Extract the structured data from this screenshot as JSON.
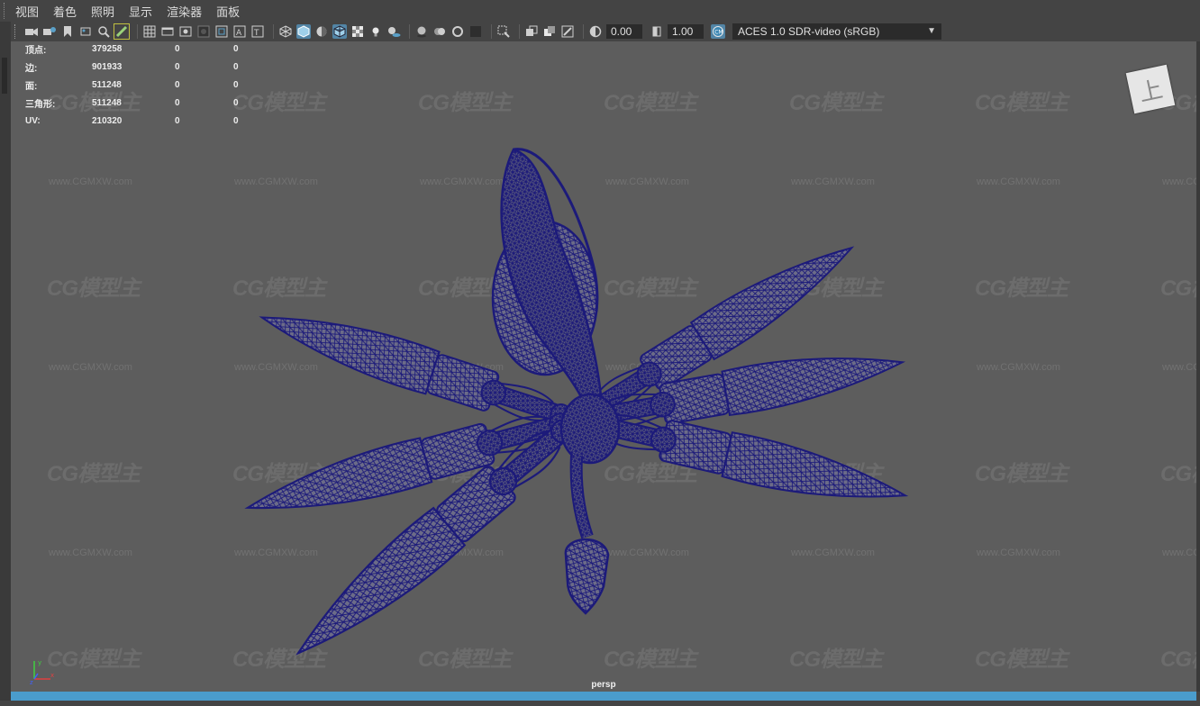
{
  "menu": {
    "items": [
      "视图",
      "着色",
      "照明",
      "显示",
      "渲染器",
      "面板"
    ]
  },
  "toolbar": {
    "tools": [
      {
        "icon": "camera-icon"
      },
      {
        "icon": "camera-attr-icon"
      },
      {
        "icon": "bookmark-icon"
      },
      {
        "icon": "image-plane-icon"
      },
      {
        "icon": "2d-pan-zoom-icon"
      },
      {
        "icon": "grease-pencil-icon"
      },
      {
        "icon": "grid-icon"
      },
      {
        "icon": "film-gate-icon"
      },
      {
        "icon": "resolution-gate-icon"
      },
      {
        "icon": "gate-mask-icon"
      },
      {
        "icon": "field-chart-icon"
      },
      {
        "icon": "safe-action-icon"
      },
      {
        "icon": "safe-title-icon"
      },
      {
        "icon": "wireframe-icon"
      },
      {
        "icon": "smooth-shade-icon"
      },
      {
        "icon": "default-material-icon"
      },
      {
        "icon": "wireframe-on-shaded-icon"
      },
      {
        "icon": "textured-icon"
      },
      {
        "icon": "use-all-lights-icon"
      },
      {
        "icon": "shadows-icon"
      },
      {
        "icon": "screen-space-ao-icon"
      },
      {
        "icon": "motion-blur-icon"
      },
      {
        "icon": "anti-aliasing-icon"
      },
      {
        "icon": "depth-of-field-icon"
      },
      {
        "icon": "isolate-select-icon"
      },
      {
        "icon": "xray-icon"
      },
      {
        "icon": "xray-active-icon"
      },
      {
        "icon": "xray-joints-icon"
      },
      {
        "icon": "backface-culling-icon"
      },
      {
        "icon": "exposure-icon"
      },
      {
        "icon": "gamma-icon"
      },
      {
        "icon": "color-management-icon"
      }
    ],
    "exposure_value": "0.00",
    "gamma_value": "1.00",
    "color_space": "ACES 1.0 SDR-video (sRGB)"
  },
  "hud": {
    "rows": [
      {
        "label": "顶点:",
        "v1": "379258",
        "v2": "0",
        "v3": "0"
      },
      {
        "label": "边:",
        "v1": "901933",
        "v2": "0",
        "v3": "0"
      },
      {
        "label": "面:",
        "v1": "511248",
        "v2": "0",
        "v3": "0"
      },
      {
        "label": "三角形:",
        "v1": "511248",
        "v2": "0",
        "v3": "0"
      },
      {
        "label": "UV:",
        "v1": "210320",
        "v2": "0",
        "v3": "0"
      }
    ]
  },
  "viewcube": {
    "label": "上"
  },
  "camera": {
    "name": "persp"
  },
  "axis": {
    "x": "x",
    "y": "y",
    "z": "z"
  },
  "watermark": {
    "logo": "CG模型主",
    "url": "www.CGMXW.com"
  },
  "colors": {
    "viewport_bg": "#5d5d5d",
    "wire": "#1c1a7a",
    "accent": "#4a9ccc"
  }
}
